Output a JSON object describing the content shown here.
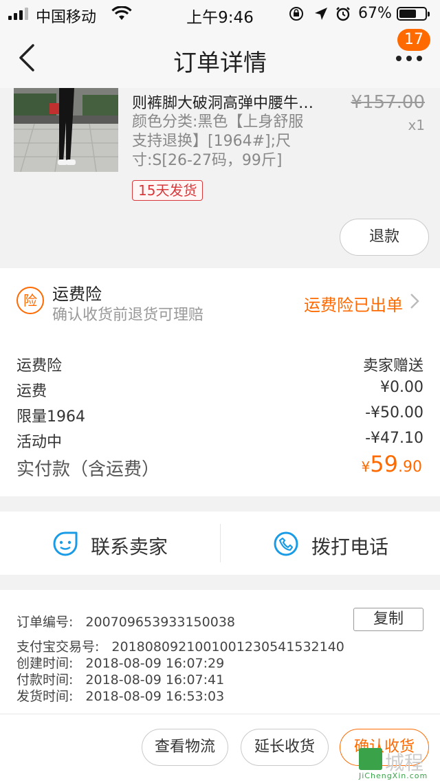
{
  "status_bar": {
    "carrier": "中国移动",
    "time": "上午9:46",
    "battery_percent": "67%",
    "battery_level": 0.67,
    "icons": [
      "signal-icon",
      "wifi-icon",
      "orientation-lock-icon",
      "location-arrow-icon",
      "alarm-icon",
      "battery-icon"
    ]
  },
  "nav": {
    "title": "订单详情",
    "back_icon": "chevron-left-icon",
    "more_icon": "more-dots-icon",
    "badge": "17"
  },
  "product": {
    "name": "则裤脚大破洞高弹中腰牛…",
    "sku_lines": [
      "颜色分类:黑色【上身舒服",
      "支持退换】[1964#];尺",
      "寸:S[26-27码，99斤]"
    ],
    "original_price": "¥157.00",
    "quantity": "x1",
    "delivery_tag": "15天发货",
    "refund_button": "退款"
  },
  "insurance": {
    "icon_char": "险",
    "title": "运费险",
    "subtitle": "确认收货前退货可理赔",
    "status": "运费险已出单"
  },
  "fees": [
    {
      "label": "运费险",
      "value": "卖家赠送"
    },
    {
      "label": "运费",
      "value": "¥0.00"
    },
    {
      "label": "限量1964",
      "value": "-¥50.00"
    },
    {
      "label": "活动中",
      "value": "-¥47.10"
    }
  ],
  "total": {
    "label": "实付款（含运费）",
    "currency": "¥",
    "integer": "59",
    "decimal": ".90"
  },
  "contact": {
    "seller_label": "联系卖家",
    "phone_label": "拨打电话"
  },
  "order_info": {
    "copy_button": "复制",
    "rows": [
      {
        "label": "订单编号:",
        "value": "200709653933150038"
      },
      {
        "label": "支付宝交易号:",
        "value": "2018080921001001230541532140"
      },
      {
        "label": "创建时间:",
        "value": "2018-08-09 16:07:29"
      },
      {
        "label": "付款时间:",
        "value": "2018-08-09 16:07:41"
      },
      {
        "label": "发货时间:",
        "value": "2018-08-09 16:53:03"
      }
    ]
  },
  "bottom_bar": {
    "logistics_button": "查看物流",
    "extend_button": "延长收货",
    "confirm_button": "确认收货"
  },
  "watermark": {
    "text": "城程",
    "url": "JiChengXin.com"
  },
  "colors": {
    "accent": "#ff6a00",
    "tag_red": "#d9383a",
    "contact_blue": "#1a9be6"
  }
}
